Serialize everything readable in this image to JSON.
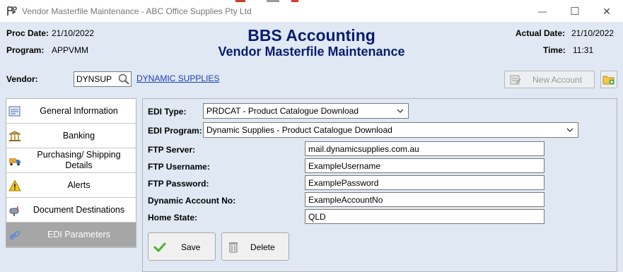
{
  "window": {
    "title": "Vendor Masterfile Maintenance - ABC Office Supplies Pty Ltd",
    "minimize_glyph": "—",
    "maximize_glyph": "☐",
    "close_glyph": "✕"
  },
  "header": {
    "proc_date_label": "Proc Date:",
    "proc_date_value": "21/10/2022",
    "program_label": "Program:",
    "program_value": "APPVMM",
    "title": "BBS Accounting",
    "subtitle": "Vendor Masterfile Maintenance",
    "actual_date_label": "Actual Date:",
    "actual_date_value": "21/10/2022",
    "time_label": "Time:",
    "time_value": "11:31"
  },
  "vendor": {
    "label": "Vendor:",
    "code": "DYNSUP",
    "name": "DYNAMIC SUPPLIES"
  },
  "toolbar": {
    "new_account_label": "New Account"
  },
  "sidebar": {
    "items": [
      {
        "label": "General Information",
        "icon": "form-icon"
      },
      {
        "label": "Banking",
        "icon": "bank-icon"
      },
      {
        "label": "Purchasing/ Shipping Details",
        "icon": "truck-icon"
      },
      {
        "label": "Alerts",
        "icon": "warning-icon"
      },
      {
        "label": "Document Destinations",
        "icon": "mailbox-icon"
      },
      {
        "label": "EDI Parameters",
        "icon": "link-icon",
        "active": true
      }
    ]
  },
  "edi": {
    "type_label": "EDI Type:",
    "type_value": "PRDCAT - Product Catalogue Download",
    "program_label": "EDI Program:",
    "program_value": "Dynamic Supplies - Product Catalogue Download",
    "ftp_server_label": "FTP Server:",
    "ftp_server_value": "mail.dynamicsupplies.com.au",
    "ftp_username_label": "FTP Username:",
    "ftp_username_value": "ExampleUsername",
    "ftp_password_label": "FTP Password:",
    "ftp_password_value": "ExamplePassword",
    "dynamic_account_label": "Dynamic Account No:",
    "dynamic_account_value": "ExampleAccountNo",
    "home_state_label": "Home State:",
    "home_state_value": "QLD"
  },
  "actions": {
    "save_label": "Save",
    "delete_label": "Delete"
  },
  "colors": {
    "background": "#dfe8f3",
    "title_navy": "#0b1c6e",
    "link_blue": "#1a3eb3",
    "active_item": "#a6a6a6"
  }
}
